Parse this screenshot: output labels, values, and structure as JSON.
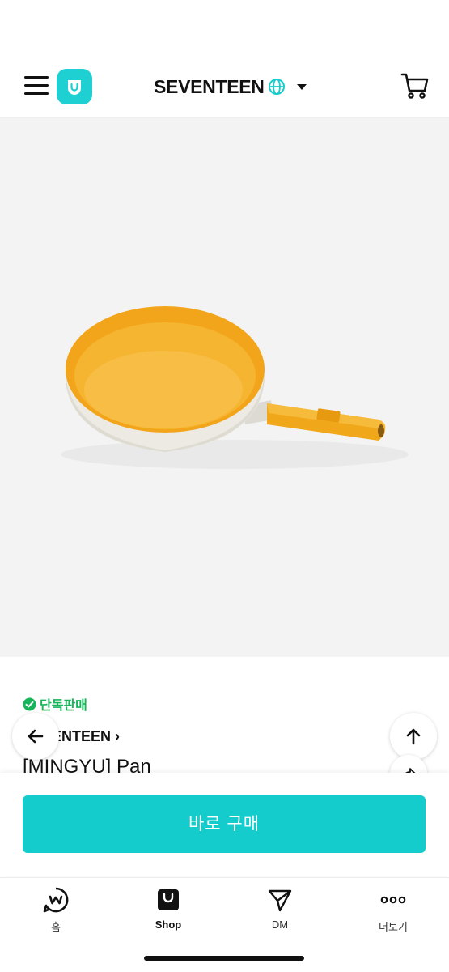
{
  "header": {
    "artist_name": "SEVENTEEN",
    "icons": [
      "menu-icon",
      "weverse-shop-logo",
      "globe-icon",
      "caret-down-icon",
      "cart-icon"
    ]
  },
  "colors": {
    "accent": "#14cccc",
    "exclusive_green": "#18b45a",
    "image_bg": "#f3f3f3",
    "pan_yellow": "#f2a81c",
    "pan_body": "#ecebe4"
  },
  "product": {
    "exclusive_label": "단독판매",
    "brand": "SEVENTEEN",
    "title": "[MINGYU] Pan"
  },
  "purchase": {
    "buy_now_label": "바로 구매"
  },
  "tabs": [
    {
      "label": "홈",
      "icon": "weverse-home-icon"
    },
    {
      "label": "Shop",
      "icon": "shop-bag-icon"
    },
    {
      "label": "DM",
      "icon": "paper-plane-icon"
    },
    {
      "label": "더보기",
      "icon": "more-dots-icon"
    }
  ]
}
